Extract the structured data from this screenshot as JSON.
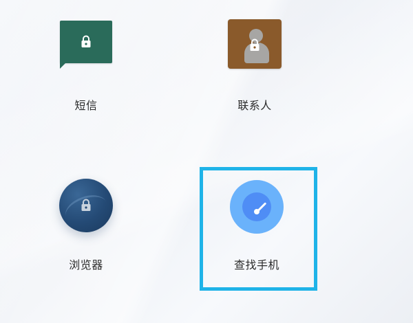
{
  "apps": [
    {
      "id": "sms",
      "label": "短信",
      "icon": "sms-bubble-icon",
      "locked": true,
      "selected": false,
      "color": "#2a6b5a"
    },
    {
      "id": "contacts",
      "label": "联系人",
      "icon": "contacts-icon",
      "locked": true,
      "selected": false,
      "color": "#8a5a2b"
    },
    {
      "id": "browser",
      "label": "浏览器",
      "icon": "browser-icon",
      "locked": true,
      "selected": false,
      "color": "#244a75"
    },
    {
      "id": "findphone",
      "label": "查找手机",
      "icon": "radar-icon",
      "locked": false,
      "selected": true,
      "color": "#6ab2fb"
    }
  ],
  "selection_color": "#1fb3e8"
}
